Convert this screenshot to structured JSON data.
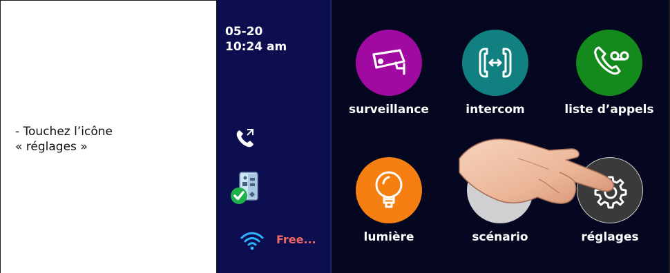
{
  "instruction": {
    "line1": "- Touchez l’icône",
    "line2": "« réglages »"
  },
  "status": {
    "date": "05-20",
    "time": "10:24 am",
    "wifi_name": "Free..."
  },
  "apps": [
    {
      "label": "surveillance",
      "icon": "camera-icon",
      "color": "#a10aa1"
    },
    {
      "label": "intercom",
      "icon": "intercom-icon",
      "color": "#108080"
    },
    {
      "label": "liste d’appels",
      "icon": "voicemail-call-icon",
      "color": "#138a1b"
    },
    {
      "label": "lumière",
      "icon": "bulb-icon",
      "color": "#f58011"
    },
    {
      "label": "scénario",
      "icon": "scenario-icon",
      "color": "#d0d0d2"
    },
    {
      "label": "réglages",
      "icon": "gear-icon",
      "color": "#3a3a3a"
    }
  ],
  "colors": {
    "left_panel": "#0d0e4f",
    "right_panel": "#05061f",
    "wifi_text": "#f06a63"
  }
}
